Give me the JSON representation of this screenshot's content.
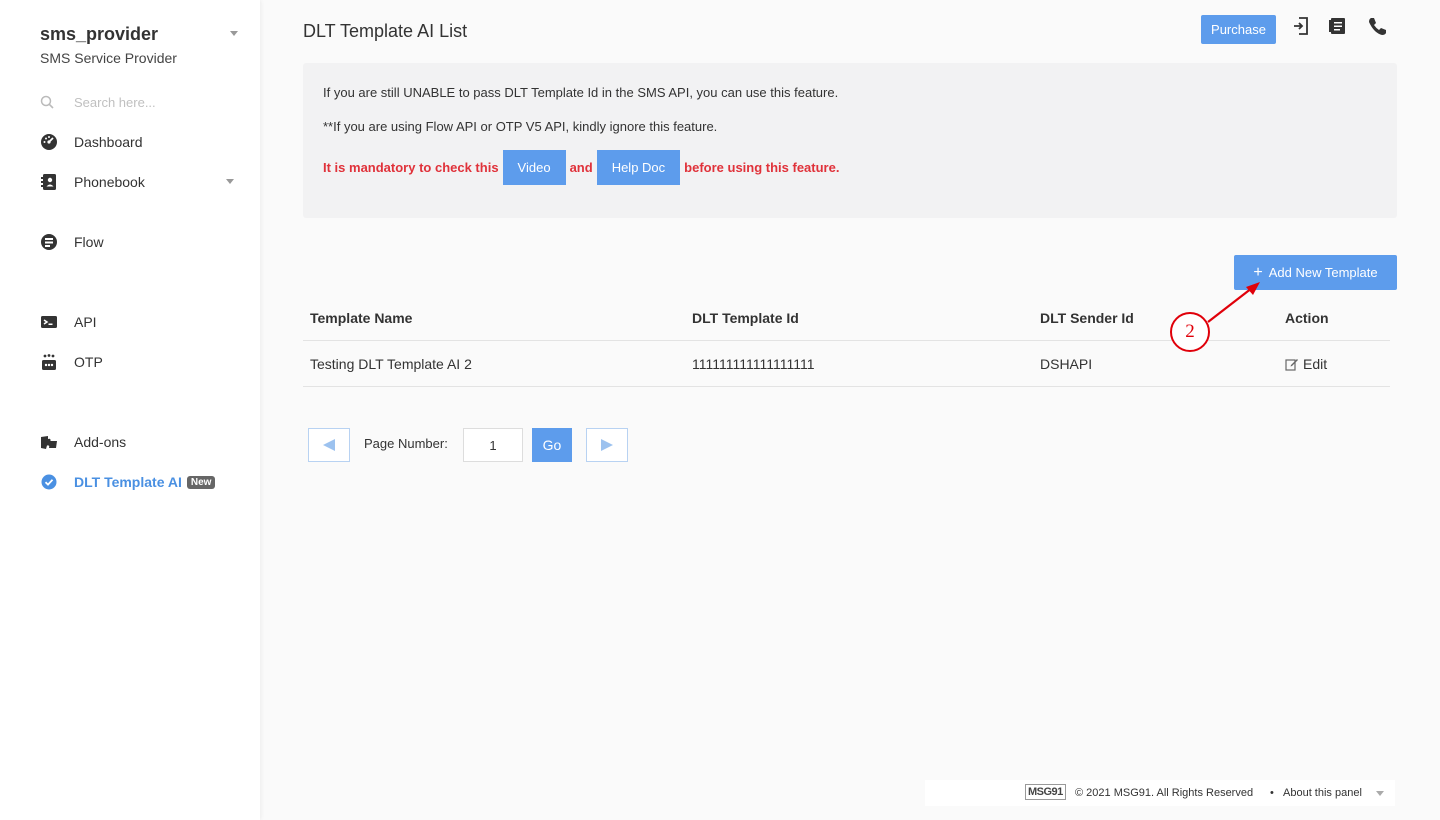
{
  "sidebar": {
    "account_name": "sms_provider",
    "account_subtitle": "SMS Service Provider",
    "search_placeholder": "Search here...",
    "items": [
      {
        "label": "Dashboard"
      },
      {
        "label": "Phonebook"
      },
      {
        "label": "Flow"
      },
      {
        "label": "API"
      },
      {
        "label": "OTP"
      },
      {
        "label": "Add-ons"
      },
      {
        "label": "DLT Template AI",
        "badge": "New"
      }
    ]
  },
  "header": {
    "title": "DLT Template AI List",
    "purchase_label": "Purchase"
  },
  "info": {
    "line1": "If you are still UNABLE to pass DLT Template Id in the SMS API, you can use this feature.",
    "line2": "**If you are using Flow API or OTP V5 API, kindly ignore this feature.",
    "warn_prefix": "It is mandatory to check this",
    "video_label": "Video",
    "and_text": "and",
    "helpdoc_label": "Help Doc",
    "warn_suffix": "before using this feature."
  },
  "add_button_label": "Add New Template",
  "table": {
    "headers": [
      "Template Name",
      "DLT Template Id",
      "DLT Sender Id",
      "Action"
    ],
    "rows": [
      {
        "name": "Testing DLT Template AI 2",
        "template_id": "111111111111111111",
        "sender_id": "DSHAPI",
        "action": "Edit"
      }
    ]
  },
  "pagination": {
    "label": "Page Number:",
    "value": "1",
    "go_label": "Go"
  },
  "annotation": {
    "number": "2"
  },
  "footer": {
    "logo": "MSG91",
    "copyright": "© 2021 MSG91. All Rights Reserved",
    "separator": "•",
    "about": "About this panel"
  },
  "colors": {
    "accent": "#5d9cec",
    "active_nav": "#4a90e2",
    "warning": "#e0323a",
    "annotation": "#e0000a"
  }
}
